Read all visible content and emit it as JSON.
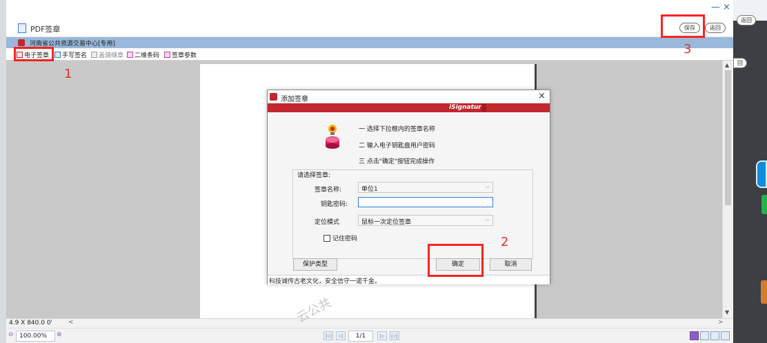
{
  "window": {
    "title": "PDF签章",
    "save_label": "保存",
    "back_label": "返回",
    "minimize_glyph": "—",
    "close_glyph": "×"
  },
  "outer": {
    "back_label": "返回",
    "back_label2": "回"
  },
  "org": {
    "name": "河南省公共资源交易中心[专用]"
  },
  "toolbar": {
    "items": [
      {
        "label": "电子签章",
        "icon": "seal-icon"
      },
      {
        "label": "手写签名",
        "icon": "pen-icon"
      },
      {
        "label": "盖骑缝章",
        "icon": "stamp-icon"
      },
      {
        "label": "二维条码",
        "icon": "qrcode-icon"
      },
      {
        "label": "签章参数",
        "icon": "settings-icon"
      }
    ]
  },
  "status": {
    "coords": "4.9 X 840.0 0'",
    "zoom": "100.00%",
    "page": "1/1"
  },
  "dialog": {
    "title": "添加签章",
    "brand": "iSignature",
    "steps": [
      "一 选择下拉框内的签章名称",
      "二 输入电子钥匙盘用户密码",
      "三 点击\"确定\"按钮完成操作"
    ],
    "group_label": "请选择签章:",
    "seal_name_label": "签章名称:",
    "seal_name_value": "单位1",
    "key_password_label": "钥匙密码:",
    "key_password_value": "",
    "position_mode_label": "定位模式",
    "position_mode_value": "鼠标一次定位签章",
    "remember_label": "记住密码",
    "protect_button": "保护类型",
    "ok_button": "确定",
    "cancel_button": "取消",
    "footer": "科技诚传古老文化，安全信守一诺千金。"
  },
  "annotations": {
    "step1": "1",
    "step2": "2",
    "step3": "3",
    "color": "#ff2020"
  },
  "watermark": "云公共"
}
